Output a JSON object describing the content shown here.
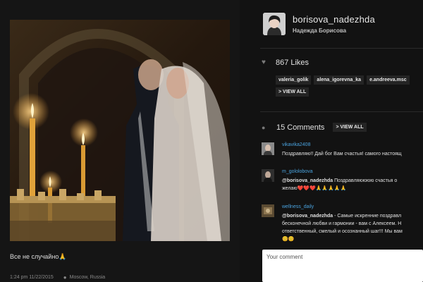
{
  "post": {
    "caption": "Все не случайно🙏",
    "time": "1:24 pm 11/22/2015",
    "location": "Moscow, Russia"
  },
  "profile": {
    "username": "borisova_nadezhda",
    "full_name": "Надежда Борисова"
  },
  "likes": {
    "count": "867",
    "label": "Likes",
    "users": [
      "valeria_golik",
      "alena_igorevna_ka",
      "e.andreeva.msc"
    ],
    "view_all": "> VIEW ALL"
  },
  "comments": {
    "count": "15",
    "label": "Comments",
    "view_all": "> VIEW ALL",
    "items": [
      {
        "user": "vikavika2408",
        "text": "Поздравляю!! Дай бог Вам счастья! самого настоящ"
      },
      {
        "user": "m_gololobova",
        "mention": "@borisova_nadezhda",
        "text": " Поздравляюююю счастья о",
        "text2": "желаю❤️❤️❤️🙏🙏🙏🙏🙏"
      },
      {
        "user": "wellness_daily",
        "mention": "@borisova_nadezhda",
        "text": " - Самые искренние поздравл",
        "text2": "бесконечной любви и гармонии - вам с Алексеем. Н",
        "text3": "ответственный, смелый и осознанный шаг!!! Мы вам",
        "text4": "😊😊"
      }
    ]
  },
  "comment_input": {
    "placeholder": "Your comment"
  },
  "colors": {
    "background": "#121212",
    "link": "#4aa3df",
    "tag_bg": "#242424"
  }
}
